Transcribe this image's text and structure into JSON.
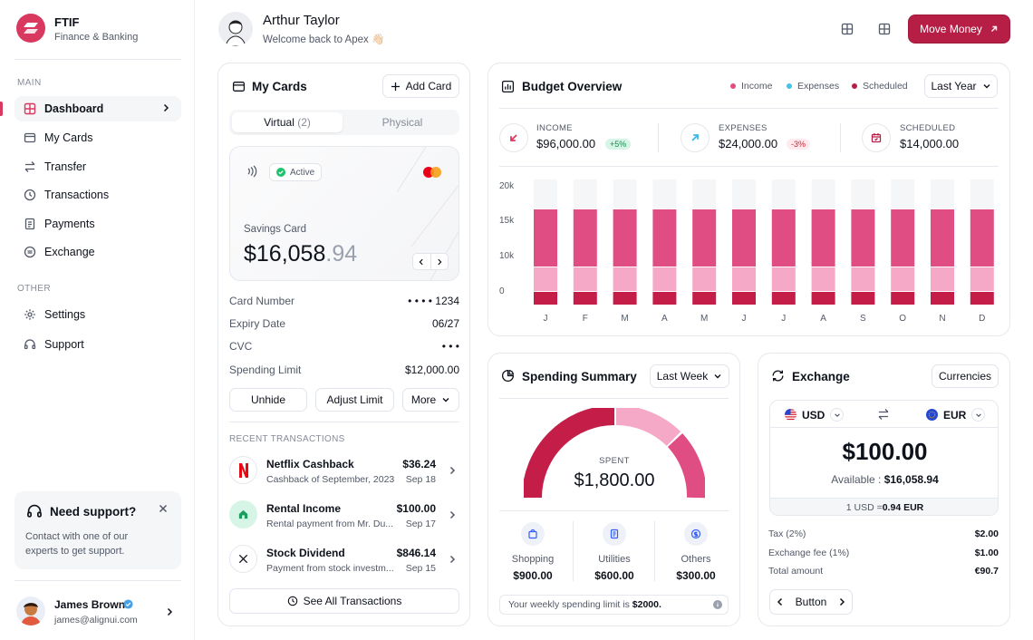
{
  "brand": {
    "name": "FTIF",
    "subtitle": "Finance & Banking"
  },
  "sidebar": {
    "section_main": "MAIN",
    "section_other": "OTHER",
    "main_items": [
      {
        "label": "Dashboard",
        "icon": "grid-icon",
        "active": true
      },
      {
        "label": "My Cards",
        "icon": "card-icon"
      },
      {
        "label": "Transfer",
        "icon": "transfer-icon"
      },
      {
        "label": "Transactions",
        "icon": "history-icon"
      },
      {
        "label": "Payments",
        "icon": "document-icon"
      },
      {
        "label": "Exchange",
        "icon": "currency-icon"
      }
    ],
    "other_items": [
      {
        "label": "Settings",
        "icon": "gear-icon"
      },
      {
        "label": "Support",
        "icon": "headset-icon"
      }
    ],
    "support": {
      "title": "Need support?",
      "text": "Contact with one of our experts to get support."
    },
    "user": {
      "name": "James Brown",
      "email": "james@alignui.com"
    }
  },
  "header": {
    "name": "Arthur Taylor",
    "welcome": "Welcome back to Apex 👋🏻",
    "move_money": "Move Money"
  },
  "my_cards": {
    "title": "My Cards",
    "add_card": "Add Card",
    "tabs": {
      "virtual": "Virtual",
      "virtual_count": "(2)",
      "physical": "Physical"
    },
    "card": {
      "status": "Active",
      "name": "Savings Card",
      "balance_main": "$16,058",
      "balance_decimal": ".94"
    },
    "details": [
      {
        "label": "Card Number",
        "value": "• • • •  1234"
      },
      {
        "label": "Expiry Date",
        "value": "06/27"
      },
      {
        "label": "CVC",
        "value": "• • •"
      },
      {
        "label": "Spending Limit",
        "value": "$12,000.00"
      }
    ],
    "actions": {
      "unhide": "Unhide",
      "adjust": "Adjust Limit",
      "more": "More"
    },
    "recent_title": "RECENT TRANSACTIONS",
    "transactions": [
      {
        "name": "Netflix Cashback",
        "sub": "Cashback of September, 2023",
        "amount": "$36.24",
        "date": "Sep 18"
      },
      {
        "name": "Rental Income",
        "sub": "Rental payment from Mr. Du...",
        "amount": "$100.00",
        "date": "Sep 17"
      },
      {
        "name": "Stock Dividend",
        "sub": "Payment from stock investm...",
        "amount": "$846.14",
        "date": "Sep 15"
      }
    ],
    "see_all": "See All Transactions"
  },
  "budget": {
    "title": "Budget Overview",
    "legend": [
      "Income",
      "Expenses",
      "Scheduled"
    ],
    "period": "Last Year",
    "stats": [
      {
        "label": "INCOME",
        "value": "$96,000.00",
        "badge": "+5%"
      },
      {
        "label": "EXPENSES",
        "value": "$24,000.00",
        "badge": "-3%"
      },
      {
        "label": "SCHEDULED",
        "value": "$14,000.00"
      }
    ]
  },
  "chart_data": {
    "type": "bar",
    "categories": [
      "J",
      "F",
      "M",
      "A",
      "M",
      "J",
      "J",
      "A",
      "S",
      "O",
      "N",
      "D"
    ],
    "ytick_labels": [
      "20k",
      "15k",
      "10k",
      "0"
    ],
    "colors": {
      "top": "#e04d82",
      "mid": "#f5a9c6",
      "bottom": "#c31d48",
      "track": "#f5f6f8"
    }
  },
  "spending": {
    "title": "Spending Summary",
    "period": "Last Week",
    "spent_label": "SPENT",
    "spent_value": "$1,800.00",
    "categories": [
      {
        "label": "Shopping",
        "value": "$900.00",
        "icon": "bag-icon"
      },
      {
        "label": "Utilities",
        "value": "$600.00",
        "icon": "receipt-icon"
      },
      {
        "label": "Others",
        "value": "$300.00",
        "icon": "coin-icon"
      }
    ],
    "limit_note_prefix": "Your weekly spending limit is ",
    "limit_note_value": "$2000."
  },
  "exchange": {
    "title": "Exchange",
    "currencies_btn": "Currencies",
    "from": "USD",
    "to": "EUR",
    "amount": "$100.00",
    "available_label": "Available : ",
    "available_value": "$16,058.94",
    "rate_prefix": "1 USD = ",
    "rate_value": "0.94 EUR",
    "rows": [
      {
        "label": "Tax (2%)",
        "value": "$2.00"
      },
      {
        "label": "Exchange fee (1%)",
        "value": "$1.00"
      },
      {
        "label": "Total amount",
        "value": "€90.7"
      }
    ],
    "button": "Button"
  }
}
